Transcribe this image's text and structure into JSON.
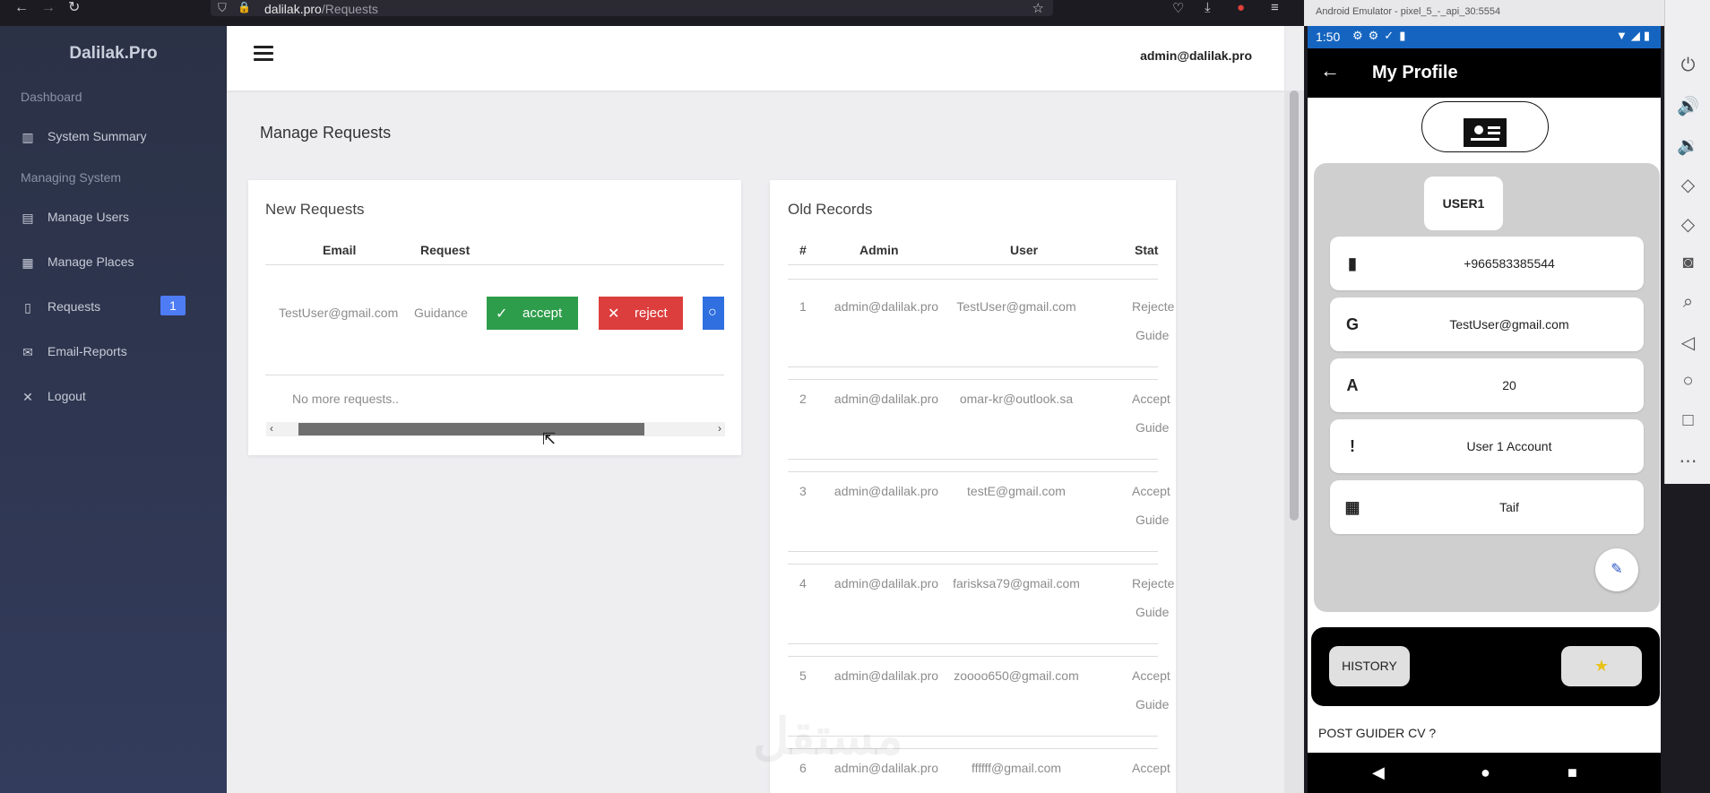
{
  "browser": {
    "url_host": "dalilak.pro",
    "url_path": "/Requests"
  },
  "sidebar": {
    "brand": "Dalilak.Pro",
    "section_dashboard": "Dashboard",
    "section_managing": "Managing System",
    "items": [
      {
        "label": "System Summary",
        "icon": "bar-chart-icon"
      },
      {
        "label": "Manage Users",
        "icon": "users-chart-icon"
      },
      {
        "label": "Manage Places",
        "icon": "calendar-icon"
      },
      {
        "label": "Requests",
        "icon": "document-icon",
        "badge": "1"
      },
      {
        "label": "Email-Reports",
        "icon": "mail-icon"
      },
      {
        "label": "Logout",
        "icon": "close-icon"
      }
    ]
  },
  "topbar": {
    "user_email": "admin@dalilak.pro"
  },
  "page": {
    "title": "Manage Requests"
  },
  "new_requests": {
    "title": "New Requests",
    "columns": [
      "Email",
      "Request"
    ],
    "row": {
      "email": "TestUser@gmail.com",
      "request": "Guidance"
    },
    "accept_label": "accept",
    "reject_label": "reject",
    "empty_text": "No more requests.."
  },
  "old_records": {
    "title": "Old Records",
    "columns": [
      "#",
      "Admin",
      "User",
      "Stat"
    ],
    "rows": [
      {
        "num": "1",
        "admin": "admin@dalilak.pro",
        "user": "TestUser@gmail.com",
        "status": "Rejecte",
        "type": "Guide"
      },
      {
        "num": "2",
        "admin": "admin@dalilak.pro",
        "user": "omar-kr@outlook.sa",
        "status": "Accept",
        "type": "Guide"
      },
      {
        "num": "3",
        "admin": "admin@dalilak.pro",
        "user": "testE@gmail.com",
        "status": "Accept",
        "type": "Guide"
      },
      {
        "num": "4",
        "admin": "admin@dalilak.pro",
        "user": "farisksa79@gmail.com",
        "status": "Rejecte",
        "type": "Guide"
      },
      {
        "num": "5",
        "admin": "admin@dalilak.pro",
        "user": "zoooo650@gmail.com",
        "status": "Accept",
        "type": "Guide"
      },
      {
        "num": "6",
        "admin": "admin@dalilak.pro",
        "user": "ffffff@gmail.com",
        "status": "Accept",
        "type": ""
      }
    ]
  },
  "emulator": {
    "window_title": "Android Emulator - pixel_5_-_api_30:5554",
    "time": "1:50",
    "app_title": "My Profile",
    "username": "USER1",
    "fields": [
      {
        "icon_glyph": "▮",
        "icon": "phone-icon",
        "value": "+966583385544"
      },
      {
        "icon_glyph": "G",
        "icon": "google-icon",
        "value": "TestUser@gmail.com"
      },
      {
        "icon_glyph": "A",
        "icon": "age-icon",
        "value": "20"
      },
      {
        "icon_glyph": "!",
        "icon": "info-icon",
        "value": "User 1 Account"
      },
      {
        "icon_glyph": "▦",
        "icon": "city-icon",
        "value": "Taif"
      }
    ],
    "history_label": "HISTORY",
    "cv_link": "POST GUIDER CV ?"
  },
  "watermark": "مستقل",
  "colors": {
    "sidebar_bg": "#2f3753",
    "accept": "#2e9d4b",
    "reject": "#dc3d3d",
    "view": "#2f6fe0",
    "badge": "#4e7cf5",
    "emu_status": "#1565c0"
  }
}
